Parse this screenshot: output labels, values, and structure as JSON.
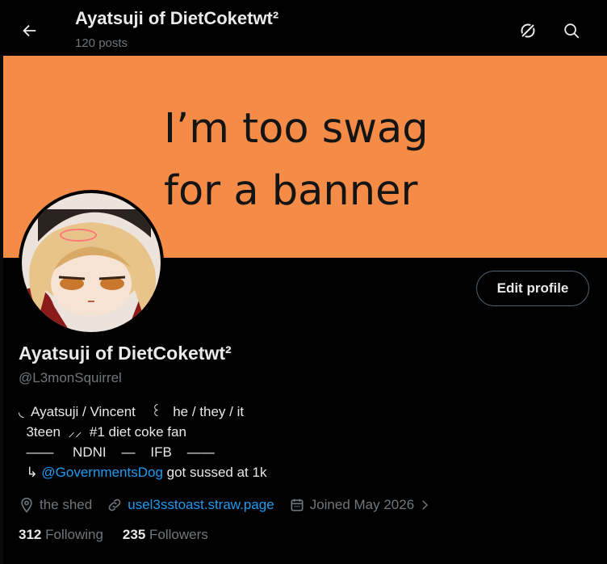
{
  "header": {
    "title": "Ayatsuji of DietCoketwt²",
    "post_count": "120 posts",
    "back_icon": "arrow-left-icon",
    "grok_icon": "grok-icon",
    "search_icon": "search-icon"
  },
  "banner": {
    "text": "I’m too swag\nfor a banner",
    "color": "#f48c47"
  },
  "profile": {
    "edit_label": "Edit profile",
    "display_name": "Ayatsuji of DietCoketwt²",
    "handle": "@L3monSquirrel",
    "bio": {
      "line1": "◟  Ayatsuji / Vincent    ꒰   he / they / it",
      "line2": "  3teen  ⸝⸝  #1 diet coke fan",
      "line3": "  ——     NDNI    —    IFB    ——",
      "line4_prefix": "  ↳ ",
      "line4_mention": "@GovernmentsDog",
      "line4_suffix": " got sussed at 1k"
    },
    "location": "the shed",
    "website": "usel3sstoast.straw.page",
    "joined": "Joined May 2026",
    "following_count": "312",
    "following_label": "Following",
    "followers_count": "235",
    "followers_label": "Followers"
  },
  "colors": {
    "accent": "#1d9bf0",
    "muted": "#71767b",
    "text": "#e7e9ea",
    "background": "#000000"
  }
}
